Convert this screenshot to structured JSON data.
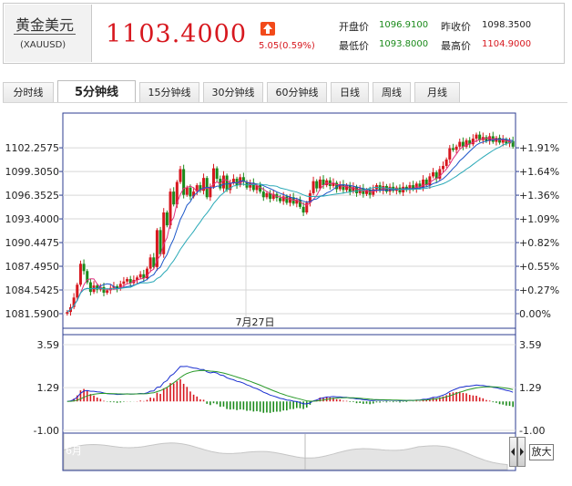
{
  "quote": {
    "name": "黄金美元",
    "code": "(XAUUSD)",
    "price": "1103.4000",
    "change": "5.05(0.59%)",
    "up_color": "#d7181f",
    "down_color": "#1a8a1a",
    "stats": [
      {
        "label": "开盘价",
        "value": "1096.9100",
        "color": "#1a8a1a"
      },
      {
        "label": "昨收价",
        "value": "1098.3500",
        "color": "#222222"
      },
      {
        "label": "最低价",
        "value": "1093.8000",
        "color": "#1a8a1a"
      },
      {
        "label": "最高价",
        "value": "1104.9000",
        "color": "#d7181f"
      }
    ]
  },
  "tabs": [
    {
      "label": "分时线",
      "active": false
    },
    {
      "label": "5分钟线",
      "active": true
    },
    {
      "label": "15分钟线",
      "active": false
    },
    {
      "label": "30分钟线",
      "active": false
    },
    {
      "label": "60分钟线",
      "active": false
    },
    {
      "label": "日线",
      "active": false
    },
    {
      "label": "周线",
      "active": false
    },
    {
      "label": "月线",
      "active": false
    }
  ],
  "zoom_label": "放大",
  "icons": {
    "up": "up-arrow-icon",
    "nav_left": "left-arrow-icon",
    "nav_right": "right-arrow-icon"
  },
  "chart_data": [
    {
      "type": "candlestick",
      "price_ticks": [
        "1102.2575",
        "1099.3050",
        "1096.3525",
        "1093.4000",
        "1090.4475",
        "1087.4950",
        "1084.5425",
        "1081.5900"
      ],
      "pct_ticks": [
        "+1.91%",
        "+1.64%",
        "+1.36%",
        "+1.09%",
        "+0.82%",
        "+0.55%",
        "+0.27%",
        "0.00%"
      ],
      "ylim": [
        1081.59,
        1104.2
      ],
      "date_label": "7月27日",
      "grid": true,
      "close": [
        1081.8,
        1082.4,
        1083.6,
        1085.2,
        1087.8,
        1086.9,
        1085.5,
        1084.3,
        1085.1,
        1084.6,
        1084.9,
        1084.2,
        1084.5,
        1084.8,
        1085.0,
        1084.7,
        1085.3,
        1085.6,
        1085.9,
        1085.4,
        1085.8,
        1086.1,
        1086.5,
        1086.0,
        1087.2,
        1088.6,
        1087.4,
        1092.0,
        1089.0,
        1094.2,
        1092.6,
        1096.8,
        1095.2,
        1098.0,
        1099.6,
        1096.4,
        1097.3,
        1096.2,
        1096.8,
        1097.6,
        1096.9,
        1098.5,
        1096.1,
        1097.4,
        1099.7,
        1098.4,
        1097.2,
        1098.8,
        1097.0,
        1097.9,
        1098.4,
        1097.6,
        1098.6,
        1098.0,
        1097.3,
        1097.9,
        1097.0,
        1097.6,
        1096.8,
        1096.1,
        1096.6,
        1095.9,
        1096.5,
        1096.0,
        1095.6,
        1096.2,
        1095.4,
        1096.1,
        1095.3,
        1095.8,
        1094.9,
        1094.2,
        1095.4,
        1096.6,
        1098.1,
        1097.2,
        1098.3,
        1097.6,
        1098.2,
        1097.5,
        1097.9,
        1097.1,
        1097.7,
        1097.0,
        1097.6,
        1096.8,
        1097.4,
        1096.6,
        1097.2,
        1096.5,
        1097.0,
        1096.4,
        1097.1,
        1097.6,
        1096.9,
        1097.5,
        1096.8,
        1097.4,
        1096.9,
        1097.3,
        1096.7,
        1097.4,
        1097.0,
        1097.6,
        1097.1,
        1097.8,
        1097.3,
        1098.3,
        1097.6,
        1098.7,
        1099.2,
        1098.4,
        1099.6,
        1100.0,
        1100.8,
        1102.2,
        1102.0,
        1102.4,
        1103.0,
        1102.4,
        1103.2,
        1102.7,
        1103.4,
        1103.9,
        1103.2,
        1103.6,
        1103.1,
        1103.7,
        1103.0,
        1103.5,
        1102.9,
        1103.3,
        1102.8,
        1103.1,
        1102.4
      ]
    },
    {
      "type": "macd",
      "ticks": [
        "3.59",
        "1.29",
        "-1.00"
      ],
      "ylim": [
        -1.0,
        3.59
      ],
      "month_labels": [
        "6月",
        "7月"
      ]
    }
  ]
}
